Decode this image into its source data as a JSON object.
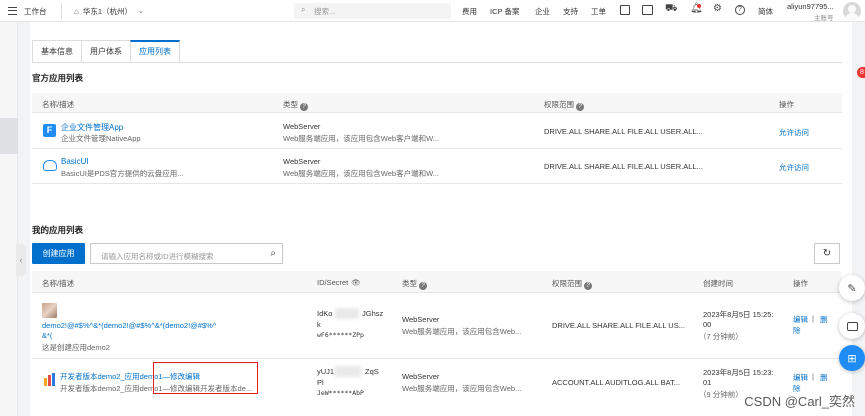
{
  "topbar": {
    "workbench": "工作台",
    "region": "华东1（杭州）",
    "search_placeholder": "搜索...",
    "nav": [
      "费用",
      "ICP 备案",
      "企业",
      "支持",
      "工单"
    ],
    "lang": "简体",
    "user_name": "aliyun97795...",
    "user_role": "主账号"
  },
  "tabs": [
    "基本信息",
    "用户体系",
    "应用列表"
  ],
  "official": {
    "title": "官方应用列表",
    "columns": [
      "名称/描述",
      "类型",
      "权限范围",
      "操作"
    ],
    "rows": [
      {
        "name": "企业文件管理App",
        "desc": "企业文件管理NativeApp",
        "type": "WebServer",
        "type_desc": "Web服务端应用，该应用包含Web客户端和W...",
        "scope": "DRIVE.ALL SHARE.ALL FILE.ALL USER.ALL...",
        "action": "允许访问"
      },
      {
        "name": "BasicUI",
        "desc": "BasicUI是PDS官方提供的云盘应用...",
        "type": "WebServer",
        "type_desc": "Web服务端应用，该应用包含Web客户端和W...",
        "scope": "DRIVE.ALL SHARE.ALL FILE.ALL USER.ALL...",
        "action": "允许访问"
      }
    ]
  },
  "mine": {
    "title": "我的应用列表",
    "create_label": "创建应用",
    "search_placeholder": "请输入应用名称或ID进行模糊搜索",
    "columns": [
      "名称/描述",
      "ID/Secret",
      "类型",
      "权限范围",
      "创建时间",
      "操作"
    ],
    "rows": [
      {
        "name_line1": "demo2!@#$%^&*(demo2!@#$%^&*(demo2!@#$%^",
        "name_line2": "&*(",
        "desc": "这是创建应用demo2",
        "id_a": "IdKo",
        "id_b": "JGhsz",
        "id_c": "k",
        "secret": "wF6******ZPp",
        "type": "WebServer",
        "type_desc": "Web服务端应用，该应用包含Web...",
        "scope": "DRIVE.ALL  SHARE.ALL  FILE.ALL  US...",
        "time": "2023年8月5日 15:25:",
        "time2": "00",
        "ago": "（7 分钟前）",
        "edit": "编辑",
        "sep": "|",
        "del_a": "删",
        "del_b": "除"
      },
      {
        "name": "开发者版本demo2_应用demo1—修改编辑",
        "desc": "开发者版本demo2_应用demo1—修改编辑开发者版本de...",
        "id_a": "yUJ1",
        "id_b": "ZqS",
        "id_c": "Pl",
        "secret": "JeW******AbP",
        "type": "WebServer",
        "type_desc": "Web服务端应用，该应用包含Web...",
        "scope": "ACCOUNT.ALL  AUDITLOG.ALL  BAT...",
        "time": "2023年8月5日 15:23:",
        "time2": "01",
        "ago": "（9 分钟前）",
        "edit": "编辑",
        "sep": "|",
        "del_a": "删",
        "del_b": "除"
      }
    ]
  },
  "badge_count": "8",
  "watermark": "CSDN @Carl_奕然",
  "colors": {
    "accent": "#0070cc",
    "highlight_box": "#e02020"
  }
}
